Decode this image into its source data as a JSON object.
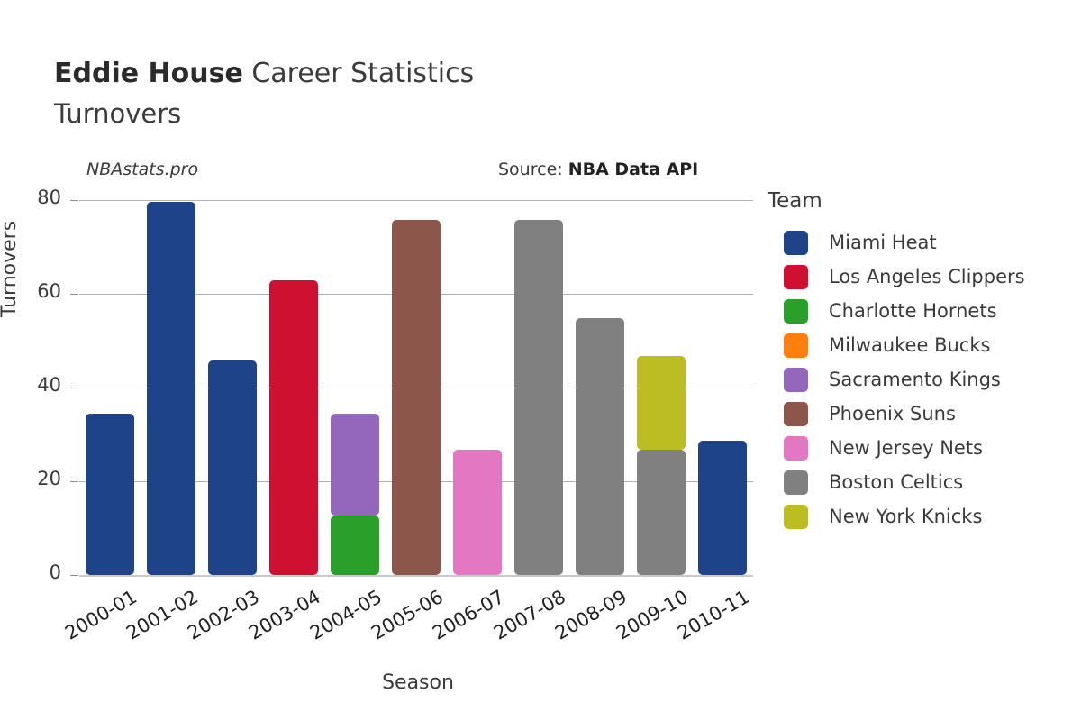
{
  "header": {
    "title_strong": "Eddie House",
    "title_rest": " Career Statistics",
    "subtitle": "Turnovers"
  },
  "annotations": {
    "watermark": "NBAstats.pro",
    "source_prefix": "Source: ",
    "source_name": "NBA Data API"
  },
  "legend": {
    "title": "Team"
  },
  "chart_data": {
    "type": "bar",
    "stacked": true,
    "title": "Eddie House Career Statistics",
    "subtitle": "Turnovers",
    "xlabel": "Season",
    "ylabel": "Turnovers",
    "ylim": [
      0,
      80
    ],
    "yticks": [
      0,
      20,
      40,
      60,
      80
    ],
    "ytick_labels": [
      "0",
      "20",
      "40",
      "60",
      "80"
    ],
    "grid": true,
    "legend_position": "right",
    "legend_title": "Team",
    "categories": [
      "2000-01",
      "2001-02",
      "2002-03",
      "2003-04",
      "2004-05",
      "2005-06",
      "2006-07",
      "2007-08",
      "2008-09",
      "2009-10",
      "2010-11"
    ],
    "series": [
      {
        "name": "Miami Heat",
        "color": "#1f4388",
        "values": [
          34.5,
          79.7,
          45.7,
          0,
          0,
          0,
          0,
          0,
          0,
          0,
          28.7
        ]
      },
      {
        "name": "Los Angeles Clippers",
        "color": "#cf1030",
        "values": [
          0,
          0,
          0,
          62.8,
          0,
          0,
          0,
          0,
          0,
          0,
          0
        ]
      },
      {
        "name": "Charlotte Hornets",
        "color": "#2aa02a",
        "values": [
          0,
          0,
          0,
          0,
          12.7,
          0,
          0,
          0,
          0,
          0,
          0
        ]
      },
      {
        "name": "Milwaukee Bucks",
        "color": "#ff7f0e",
        "values": [
          0,
          0,
          0,
          0,
          0,
          0,
          0,
          0,
          0,
          0,
          0
        ]
      },
      {
        "name": "Sacramento Kings",
        "color": "#9467bd",
        "values": [
          0,
          0,
          0,
          0,
          21.8,
          0,
          0,
          0,
          0,
          0,
          0
        ]
      },
      {
        "name": "Phoenix Suns",
        "color": "#8c564b",
        "values": [
          0,
          0,
          0,
          0,
          0,
          75.8,
          0,
          0,
          0,
          0,
          0
        ]
      },
      {
        "name": "New Jersey Nets",
        "color": "#e377c2",
        "values": [
          0,
          0,
          0,
          0,
          0,
          0,
          26.8,
          0,
          0,
          0,
          0
        ]
      },
      {
        "name": "Boston Celtics",
        "color": "#808080",
        "values": [
          0,
          0,
          0,
          0,
          0,
          0,
          0,
          75.8,
          54.8,
          26.8,
          0
        ]
      },
      {
        "name": "New York Knicks",
        "color": "#bcbd22",
        "values": [
          0,
          0,
          0,
          0,
          0,
          0,
          0,
          0,
          0,
          19.9,
          0
        ]
      }
    ],
    "stack_totals": [
      34.5,
      79.7,
      45.7,
      62.8,
      34.5,
      75.8,
      26.8,
      75.8,
      54.8,
      46.7,
      28.7
    ]
  }
}
